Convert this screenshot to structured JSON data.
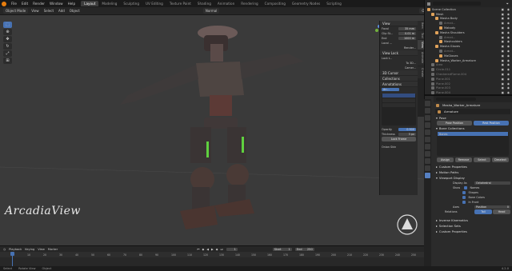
{
  "topbar": {
    "menus": [
      "File",
      "Edit",
      "Render",
      "Window",
      "Help"
    ],
    "tabs": [
      "Layout",
      "Modeling",
      "Sculpting",
      "UV Editing",
      "Texture Paint",
      "Shading",
      "Animation",
      "Rendering",
      "Compositing",
      "Geometry Nodes",
      "Scripting"
    ],
    "active_tab": "Layout",
    "scene": "Scene",
    "view_layer": "ViewLayer"
  },
  "viewport_header": {
    "mode": "Object Mode",
    "menus": [
      "View",
      "Select",
      "Add",
      "Object"
    ],
    "orientation": "Normal",
    "options": "Options"
  },
  "npanel": {
    "view_title": "View",
    "focal_label": "Focal",
    "focal_value": "35 mm",
    "clip_label": "Clip St...",
    "clip_start": "0.01 m",
    "end_label": "End",
    "clip_end": "1000 m",
    "local_label": "Local ...",
    "render_label": "Render...",
    "view_lock_title": "View Lock",
    "lock_to": "Lock t...",
    "to_3d": "To 3D...",
    "camera": "Camer...",
    "cursor_title": "3D Cursor",
    "collections_title": "Collections",
    "annotations_title": "Annotations",
    "anno_name": "An...",
    "opacity_label": "Opacity",
    "opacity_value": "0.900",
    "thickness_label": "Thickness",
    "thickness_value": "3 px",
    "lock_frame": "Lock Frame",
    "onion": "Onion Skin",
    "tabs": [
      "Item",
      "Tool",
      "View",
      "Animate",
      "Create"
    ]
  },
  "outliner": {
    "rows": [
      {
        "label": "Scene Collection",
        "indent": 0,
        "dim": false
      },
      {
        "label": "Mesh",
        "indent": 1,
        "dim": false
      },
      {
        "label": "Masha Body",
        "indent": 2,
        "dim": false
      },
      {
        "label": "Armat...",
        "indent": 3,
        "dim": true
      },
      {
        "label": "Mabody",
        "indent": 3,
        "dim": false
      },
      {
        "label": "Masha Shoulders",
        "indent": 2,
        "dim": false
      },
      {
        "label": "Armat...",
        "indent": 3,
        "dim": true
      },
      {
        "label": "Mashoulders",
        "indent": 3,
        "dim": false
      },
      {
        "label": "Masha Gloves",
        "indent": 2,
        "dim": false
      },
      {
        "label": "Armat...",
        "indent": 3,
        "dim": true
      },
      {
        "label": "MaGloves",
        "indent": 3,
        "dim": false
      },
      {
        "label": "Masha_Worker_Armature",
        "indent": 2,
        "dim": false
      },
      {
        "label": "Area",
        "indent": 1,
        "dim": true
      },
      {
        "label": "Circle.011",
        "indent": 1,
        "dim": true
      },
      {
        "label": "CheckeredFlame.004",
        "indent": 1,
        "dim": true
      },
      {
        "label": "Plane.001",
        "indent": 1,
        "dim": true
      },
      {
        "label": "Plane.002",
        "indent": 1,
        "dim": true
      },
      {
        "label": "Plane.003",
        "indent": 1,
        "dim": true
      },
      {
        "label": "Plane.004",
        "indent": 1,
        "dim": true
      }
    ]
  },
  "properties": {
    "search_placeholder": "",
    "object_name": "Masha_Worker_Armature",
    "data_name": "Armature",
    "pose_title": "Pose",
    "pose_position": "Pose Position",
    "rest_position": "Rest Position",
    "bone_collections_title": "Bone Collections",
    "bone_collection": "Bones",
    "assign": "Assign",
    "remove": "Remove",
    "select": "Select",
    "deselect": "Deselect",
    "custom_props": "Custom Properties",
    "motion_paths": "Motion Paths",
    "viewport_display": "Viewport Display",
    "display_as_label": "Display As",
    "display_as_value": "Octahedral",
    "show_label": "Show",
    "names": "Names",
    "shapes": "Shapes",
    "bone_colors": "Bone Colors",
    "in_front": "In Front",
    "axes": "Axes",
    "position_label": "Position",
    "position_value": "0",
    "relations_label": "Relations",
    "tail": "Tail",
    "head": "Head",
    "inverse_kinematics": "Inverse Kinematics",
    "selection_sets": "Selection Sets",
    "custom_properties2": "Custom Properties"
  },
  "timeline": {
    "menus": [
      "Playback",
      "Keying",
      "View",
      "Marker"
    ],
    "current_frame": "1",
    "start_label": "Start",
    "start": "1",
    "end_label": "End",
    "end": "250",
    "ticks": [
      "0",
      "10",
      "20",
      "30",
      "40",
      "50",
      "60",
      "70",
      "80",
      "90",
      "100",
      "110",
      "120",
      "130",
      "140",
      "150",
      "160",
      "170",
      "180",
      "190",
      "200",
      "210",
      "220",
      "230",
      "240",
      "250"
    ]
  },
  "status": {
    "select": "Select",
    "rotate": "Rotate View",
    "object": "Object",
    "version": "4.2.0"
  },
  "watermark": "ArcadiaView",
  "colors": {
    "accent": "#4772b3",
    "active_tab": "#3d3d3d",
    "blender_orange": "#e87d0d"
  }
}
